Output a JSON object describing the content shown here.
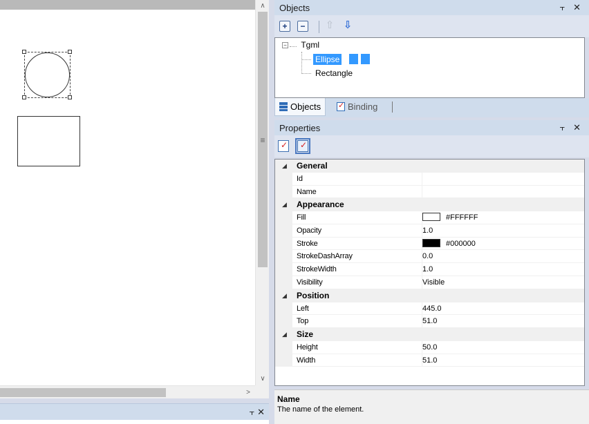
{
  "objects_panel": {
    "title": "Objects",
    "pin_icon": "pin-icon",
    "close_glyph": "✕",
    "toolbar": {
      "expand_glyph": "+",
      "collapse_glyph": "−",
      "move_up_glyph": "⇧",
      "move_down_glyph": "⇩"
    },
    "tree": {
      "root_label": "Tgml",
      "root_expander": "−",
      "items": [
        {
          "label": "Ellipse",
          "selected": true
        },
        {
          "label": "Rectangle",
          "selected": false
        }
      ]
    },
    "tabs": [
      {
        "label": "Objects",
        "active": true
      },
      {
        "label": "Binding",
        "active": false
      }
    ]
  },
  "properties_panel": {
    "title": "Properties",
    "close_glyph": "✕",
    "categories": [
      {
        "label": "General",
        "rows": [
          {
            "name": "Id",
            "value": ""
          },
          {
            "name": "Name",
            "value": ""
          }
        ]
      },
      {
        "label": "Appearance",
        "rows": [
          {
            "name": "Fill",
            "value": "#FFFFFF",
            "swatch": "#FFFFFF"
          },
          {
            "name": "Opacity",
            "value": "1.0"
          },
          {
            "name": "Stroke",
            "value": "#000000",
            "swatch": "#000000"
          },
          {
            "name": "StrokeDashArray",
            "value": "0.0"
          },
          {
            "name": "StrokeWidth",
            "value": "1.0"
          },
          {
            "name": "Visibility",
            "value": "Visible"
          }
        ]
      },
      {
        "label": "Position",
        "rows": [
          {
            "name": "Left",
            "value": "445.0"
          },
          {
            "name": "Top",
            "value": "51.0"
          }
        ]
      },
      {
        "label": "Size",
        "rows": [
          {
            "name": "Height",
            "value": "50.0"
          },
          {
            "name": "Width",
            "value": "51.0"
          }
        ]
      }
    ],
    "description": {
      "title": "Name",
      "text": "The name of the element."
    }
  },
  "bottom_panel": {
    "close_glyph": "✕"
  },
  "colors": {
    "selection": "#3399ff",
    "panel_header": "#cfdcec",
    "accent_icon": "#2f6cb7"
  }
}
